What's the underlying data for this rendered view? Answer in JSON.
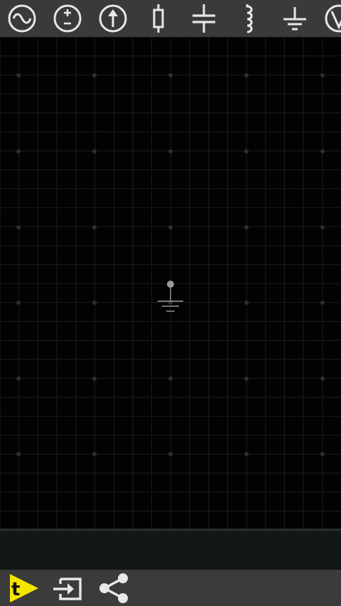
{
  "palette": {
    "tools": [
      {
        "id": "ac-source",
        "icon": "ac-source-icon"
      },
      {
        "id": "dc-source",
        "icon": "dc-voltage-source-icon"
      },
      {
        "id": "current-source",
        "icon": "current-source-icon"
      },
      {
        "id": "resistor",
        "icon": "resistor-icon"
      },
      {
        "id": "capacitor",
        "icon": "capacitor-icon"
      },
      {
        "id": "inductor",
        "icon": "inductor-icon"
      },
      {
        "id": "ground",
        "icon": "ground-icon"
      },
      {
        "id": "voltmeter",
        "icon": "voltmeter-icon"
      }
    ]
  },
  "canvas": {
    "placed_components": [
      "ground"
    ]
  },
  "status": {
    "text": ""
  },
  "bottom_bar": {
    "actions": [
      {
        "id": "simulate",
        "icon": "simulate-play-icon",
        "label": "t"
      },
      {
        "id": "export",
        "icon": "export-icon"
      },
      {
        "id": "share",
        "icon": "share-icon"
      }
    ]
  },
  "colors": {
    "toolbar_bg": "#3a3a3a",
    "icon_color": "#e8e8e8",
    "canvas_bg": "#020202",
    "grid_line": "#1c1c1c",
    "grid_dot": "#2e2e2e",
    "component_color": "#9a9a9a",
    "simulate_accent": "#f5e600"
  }
}
